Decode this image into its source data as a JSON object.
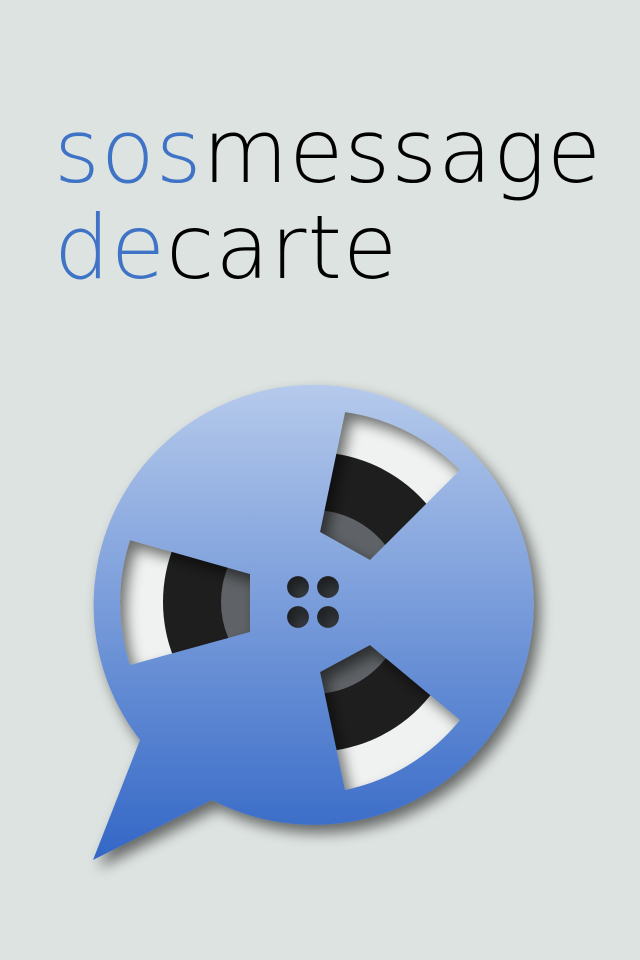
{
  "splash": {
    "title_line1": {
      "accent": "sos",
      "rest": "message"
    },
    "title_line2": {
      "accent": "de",
      "rest": "carte"
    }
  },
  "logo": {
    "icon": "speech-bubble-reel-icon"
  },
  "colors": {
    "background": "#dde3e1",
    "accent": "#3f73c6",
    "text": "#000000",
    "bubble_top": "#b7cbec",
    "bubble_bottom": "#3367c6",
    "reel_dark": "#1e1e1e"
  }
}
